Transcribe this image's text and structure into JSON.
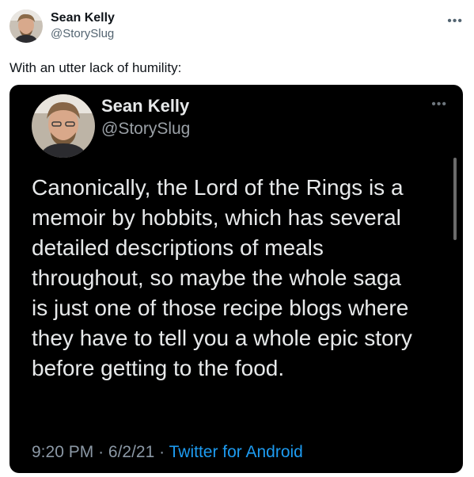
{
  "outer_tweet": {
    "name": "Sean Kelly",
    "handle": "@StorySlug",
    "more_icon": "more-horizontal-icon",
    "text": "With an utter lack of humility:"
  },
  "quoted_tweet": {
    "name": "Sean Kelly",
    "handle": "@StorySlug",
    "more_icon": "more-horizontal-icon",
    "body_lines": [
      "Canonically, the Lord of the Rings is a",
      "memoir by hobbits, which has several",
      "detailed descriptions of meals",
      "throughout, so maybe the whole saga",
      "is just one of those recipe blogs where",
      "they have to tell you a whole epic story",
      "before getting to the food."
    ],
    "time": "9:20 PM",
    "date": "6/2/21",
    "separator": "·",
    "source": "Twitter for Android"
  },
  "colors": {
    "card_background": "#000000",
    "link_blue": "#1d9bf0",
    "muted_gray": "#536471"
  }
}
